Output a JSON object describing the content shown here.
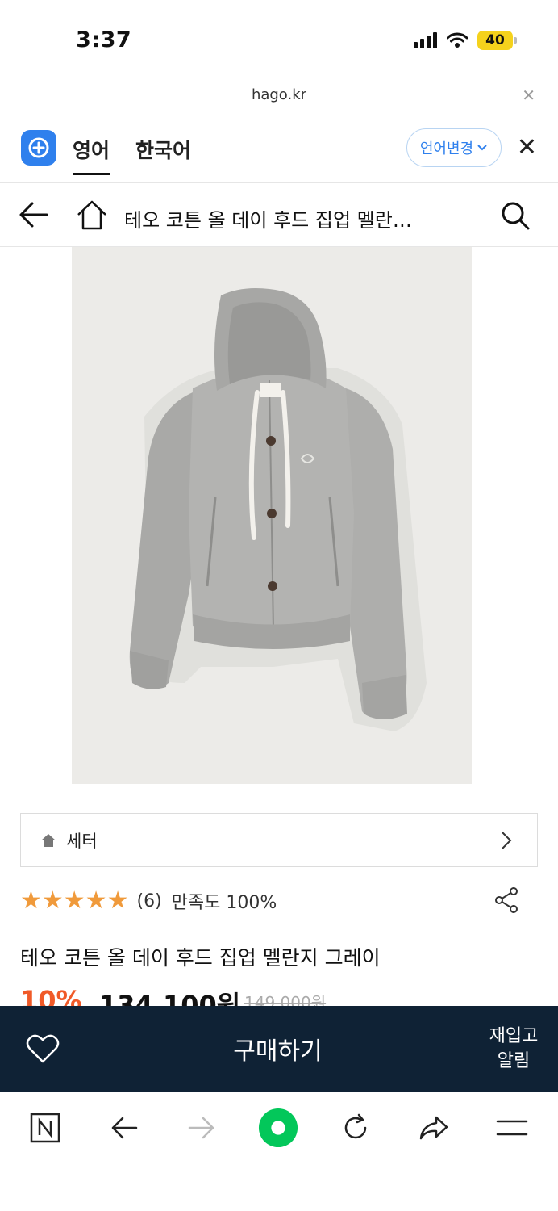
{
  "status_bar": {
    "time": "3:37",
    "battery": "40"
  },
  "url_bar": {
    "url": "hago.kr"
  },
  "translate_bar": {
    "tabs": [
      "영어",
      "한국어"
    ],
    "change_language": "언어변경"
  },
  "header": {
    "title": "테오 코튼 올 데이 후드 집업 멜란…"
  },
  "category": {
    "label": "세터"
  },
  "rating": {
    "stars": "★★★★★",
    "review_count": "(6)",
    "satisfaction": "만족도 100%"
  },
  "product": {
    "name": "테오 코튼 올 데이 후드 집업 멜란지 그레이",
    "discount": "10%",
    "price": "134,100원",
    "original_price": "149,000원"
  },
  "purchase_bar": {
    "buy_label": "구매하기",
    "restock_line1": "재입고",
    "restock_line2": "알림"
  },
  "colors": {
    "accent_blue": "#2f80ed",
    "star_orange": "#f09a3b",
    "discount_orange": "#f05a28",
    "purchase_bar_navy": "#0f2235",
    "naver_green": "#03c75a"
  }
}
